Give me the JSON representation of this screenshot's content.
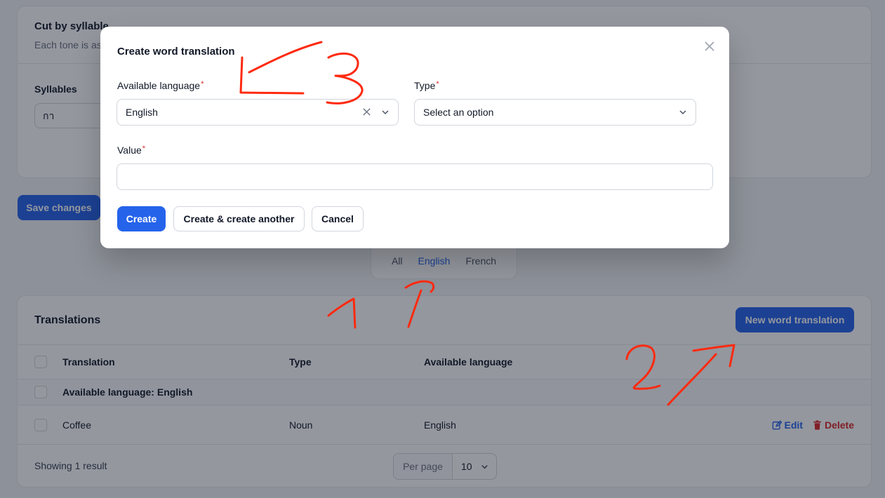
{
  "syllable_card": {
    "title": "Cut by syllable",
    "subtitle": "Each tone is as",
    "syllables_label": "Syllables",
    "syllable_value": "กา"
  },
  "save_button": "Save changes",
  "filter_tabs": [
    "All",
    "English",
    "French"
  ],
  "active_tab": "English",
  "translations": {
    "title": "Translations",
    "new_button": "New word translation",
    "columns": [
      "Translation",
      "Type",
      "Available language"
    ],
    "group_label": "Available language: English",
    "rows": [
      {
        "translation": "Coffee",
        "type": "Noun",
        "language": "English",
        "edit": "Edit",
        "delete": "Delete"
      }
    ],
    "result_count": "Showing 1 result",
    "per_page_label": "Per page",
    "per_page_value": "10"
  },
  "modal": {
    "title": "Create word translation",
    "language_label": "Available language",
    "language_value": "English",
    "type_label": "Type",
    "type_placeholder": "Select an option",
    "value_label": "Value",
    "value_value": "",
    "required_mark": "*",
    "create_button": "Create",
    "create_another_button": "Create & create another",
    "cancel_button": "Cancel"
  },
  "colors": {
    "primary": "#2563eb",
    "danger": "#dc2626",
    "annotation": "#ff2a10"
  },
  "icons": {
    "close": "close-icon",
    "chevron": "chevron-down-icon",
    "clear": "clear-icon",
    "edit": "pencil-square-icon",
    "delete": "trash-icon"
  }
}
